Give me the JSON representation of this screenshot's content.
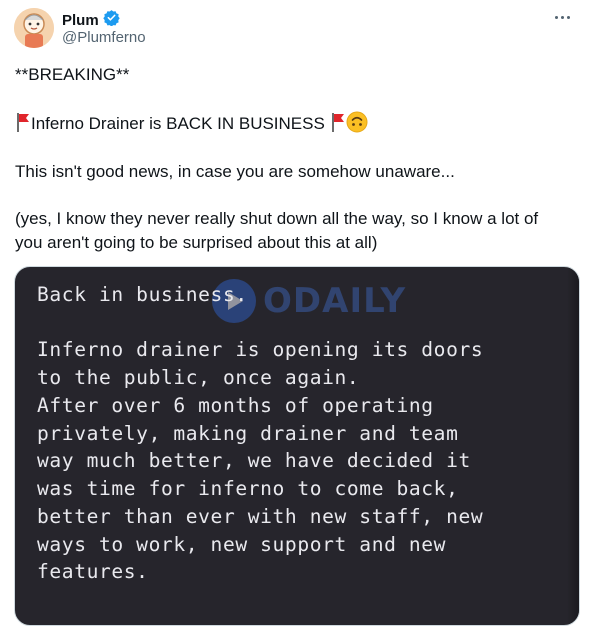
{
  "author": {
    "name": "Plum",
    "handle": "@Plumferno"
  },
  "tweet": {
    "line1": "**BREAKING**",
    "line2": "Inferno Drainer is BACK IN BUSINESS ",
    "line3": "This isn't good news, in case you are somehow unaware...",
    "line4": "(yes, I know they never really shut down all the way, so I know a lot of",
    "line5": "you aren't going to be surprised about this at all)"
  },
  "media": {
    "lines": [
      "Back in business.",
      "",
      "Inferno drainer is opening its doors",
      "to the public, once again.",
      "After over 6 months of operating",
      "privately, making drainer and team",
      "way much better, we have decided it",
      "was time for inferno to come back,",
      "better than ever with new staff, new",
      "ways to work, new support and new",
      "features."
    ],
    "watermark": "ODAILY"
  },
  "colors": {
    "verified": "#1d9bf0",
    "flag": "#e0252b",
    "media_bg": "#26252c"
  },
  "icons": [
    "verified-badge-icon",
    "more-options-icon",
    "red-flag-icon",
    "upside-down-face-icon"
  ]
}
